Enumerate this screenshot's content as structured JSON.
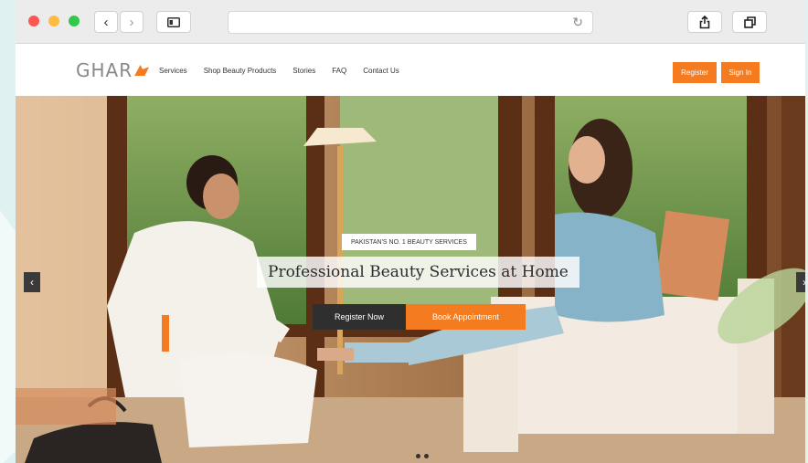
{
  "browser": {
    "back_icon": "‹",
    "forward_icon": "›",
    "reload_icon": "↻",
    "url": ""
  },
  "site": {
    "logo_text": "GHAR",
    "nav": [
      "Services",
      "Shop Beauty Products",
      "Stories",
      "FAQ",
      "Contact Us"
    ],
    "register_label": "Register",
    "signin_label": "Sign In"
  },
  "hero": {
    "tagline": "PAKISTAN'S NO. 1 BEAUTY SERVICES",
    "headline": "Professional Beauty Services at Home",
    "cta_register": "Register Now",
    "cta_book": "Book Appointment",
    "prev_icon": "‹",
    "next_icon": "›"
  },
  "colors": {
    "accent": "#f47b20",
    "dark_button": "#2f2f2f"
  }
}
